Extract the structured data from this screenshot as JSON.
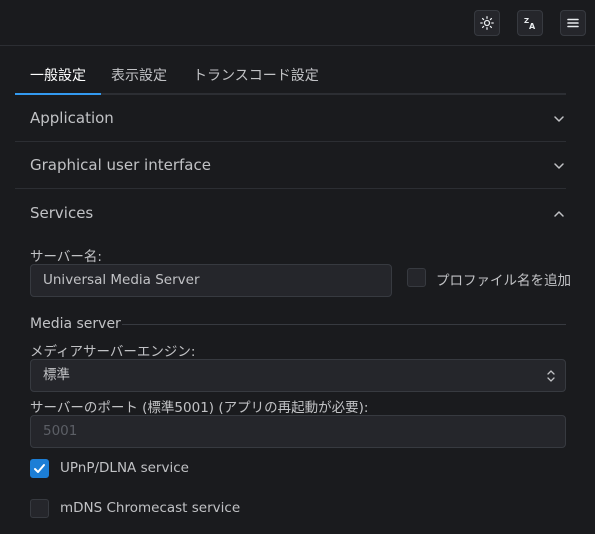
{
  "toolbar": {
    "icons": [
      "sun-icon",
      "language-icon",
      "menu-icon"
    ]
  },
  "tabs": [
    {
      "label": "一般設定",
      "active": true
    },
    {
      "label": "表示設定",
      "active": false
    },
    {
      "label": "トランスコード設定",
      "active": false
    }
  ],
  "sections": {
    "application": "Application",
    "gui": "Graphical user interface",
    "services": "Services"
  },
  "services": {
    "server_name_label": "サーバー名:",
    "server_name_value": "Universal Media Server",
    "append_profile_label": "プロファイル名を追加",
    "append_profile_checked": false,
    "media_server_heading": "Media server",
    "engine_label": "メディアサーバーエンジン:",
    "engine_value": "標準",
    "port_label": "サーバーのポート (標準5001) (アプリの再起動が必要):",
    "port_placeholder": "5001",
    "upnp_label": "UPnP/DLNA service",
    "upnp_checked": true,
    "mdns_label": "mDNS Chromecast service",
    "mdns_checked": false
  },
  "colors": {
    "accent": "#339af0",
    "checkbox_on": "#1c7ed6",
    "background": "#1a1b1e",
    "input_bg": "#25262b"
  }
}
